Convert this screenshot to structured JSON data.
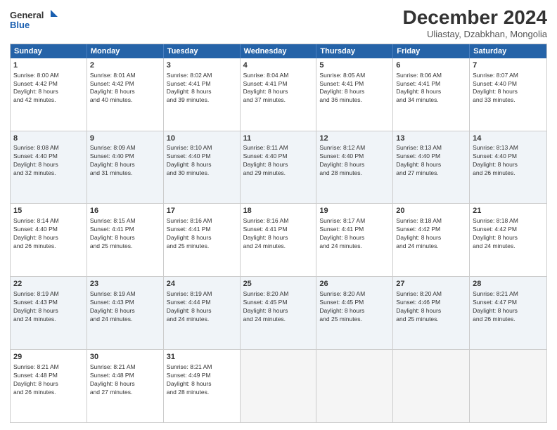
{
  "logo": {
    "line1": "General",
    "line2": "Blue"
  },
  "title": "December 2024",
  "location": "Uliastay, Dzabkhan, Mongolia",
  "header_days": [
    "Sunday",
    "Monday",
    "Tuesday",
    "Wednesday",
    "Thursday",
    "Friday",
    "Saturday"
  ],
  "weeks": [
    [
      {
        "day": "1",
        "lines": [
          "Sunrise: 8:00 AM",
          "Sunset: 4:42 PM",
          "Daylight: 8 hours",
          "and 42 minutes."
        ],
        "shaded": false
      },
      {
        "day": "2",
        "lines": [
          "Sunrise: 8:01 AM",
          "Sunset: 4:42 PM",
          "Daylight: 8 hours",
          "and 40 minutes."
        ],
        "shaded": false
      },
      {
        "day": "3",
        "lines": [
          "Sunrise: 8:02 AM",
          "Sunset: 4:41 PM",
          "Daylight: 8 hours",
          "and 39 minutes."
        ],
        "shaded": false
      },
      {
        "day": "4",
        "lines": [
          "Sunrise: 8:04 AM",
          "Sunset: 4:41 PM",
          "Daylight: 8 hours",
          "and 37 minutes."
        ],
        "shaded": false
      },
      {
        "day": "5",
        "lines": [
          "Sunrise: 8:05 AM",
          "Sunset: 4:41 PM",
          "Daylight: 8 hours",
          "and 36 minutes."
        ],
        "shaded": false
      },
      {
        "day": "6",
        "lines": [
          "Sunrise: 8:06 AM",
          "Sunset: 4:41 PM",
          "Daylight: 8 hours",
          "and 34 minutes."
        ],
        "shaded": false
      },
      {
        "day": "7",
        "lines": [
          "Sunrise: 8:07 AM",
          "Sunset: 4:40 PM",
          "Daylight: 8 hours",
          "and 33 minutes."
        ],
        "shaded": false
      }
    ],
    [
      {
        "day": "8",
        "lines": [
          "Sunrise: 8:08 AM",
          "Sunset: 4:40 PM",
          "Daylight: 8 hours",
          "and 32 minutes."
        ],
        "shaded": true
      },
      {
        "day": "9",
        "lines": [
          "Sunrise: 8:09 AM",
          "Sunset: 4:40 PM",
          "Daylight: 8 hours",
          "and 31 minutes."
        ],
        "shaded": true
      },
      {
        "day": "10",
        "lines": [
          "Sunrise: 8:10 AM",
          "Sunset: 4:40 PM",
          "Daylight: 8 hours",
          "and 30 minutes."
        ],
        "shaded": true
      },
      {
        "day": "11",
        "lines": [
          "Sunrise: 8:11 AM",
          "Sunset: 4:40 PM",
          "Daylight: 8 hours",
          "and 29 minutes."
        ],
        "shaded": true
      },
      {
        "day": "12",
        "lines": [
          "Sunrise: 8:12 AM",
          "Sunset: 4:40 PM",
          "Daylight: 8 hours",
          "and 28 minutes."
        ],
        "shaded": true
      },
      {
        "day": "13",
        "lines": [
          "Sunrise: 8:13 AM",
          "Sunset: 4:40 PM",
          "Daylight: 8 hours",
          "and 27 minutes."
        ],
        "shaded": true
      },
      {
        "day": "14",
        "lines": [
          "Sunrise: 8:13 AM",
          "Sunset: 4:40 PM",
          "Daylight: 8 hours",
          "and 26 minutes."
        ],
        "shaded": true
      }
    ],
    [
      {
        "day": "15",
        "lines": [
          "Sunrise: 8:14 AM",
          "Sunset: 4:40 PM",
          "Daylight: 8 hours",
          "and 26 minutes."
        ],
        "shaded": false
      },
      {
        "day": "16",
        "lines": [
          "Sunrise: 8:15 AM",
          "Sunset: 4:41 PM",
          "Daylight: 8 hours",
          "and 25 minutes."
        ],
        "shaded": false
      },
      {
        "day": "17",
        "lines": [
          "Sunrise: 8:16 AM",
          "Sunset: 4:41 PM",
          "Daylight: 8 hours",
          "and 25 minutes."
        ],
        "shaded": false
      },
      {
        "day": "18",
        "lines": [
          "Sunrise: 8:16 AM",
          "Sunset: 4:41 PM",
          "Daylight: 8 hours",
          "and 24 minutes."
        ],
        "shaded": false
      },
      {
        "day": "19",
        "lines": [
          "Sunrise: 8:17 AM",
          "Sunset: 4:41 PM",
          "Daylight: 8 hours",
          "and 24 minutes."
        ],
        "shaded": false
      },
      {
        "day": "20",
        "lines": [
          "Sunrise: 8:18 AM",
          "Sunset: 4:42 PM",
          "Daylight: 8 hours",
          "and 24 minutes."
        ],
        "shaded": false
      },
      {
        "day": "21",
        "lines": [
          "Sunrise: 8:18 AM",
          "Sunset: 4:42 PM",
          "Daylight: 8 hours",
          "and 24 minutes."
        ],
        "shaded": false
      }
    ],
    [
      {
        "day": "22",
        "lines": [
          "Sunrise: 8:19 AM",
          "Sunset: 4:43 PM",
          "Daylight: 8 hours",
          "and 24 minutes."
        ],
        "shaded": true
      },
      {
        "day": "23",
        "lines": [
          "Sunrise: 8:19 AM",
          "Sunset: 4:43 PM",
          "Daylight: 8 hours",
          "and 24 minutes."
        ],
        "shaded": true
      },
      {
        "day": "24",
        "lines": [
          "Sunrise: 8:19 AM",
          "Sunset: 4:44 PM",
          "Daylight: 8 hours",
          "and 24 minutes."
        ],
        "shaded": true
      },
      {
        "day": "25",
        "lines": [
          "Sunrise: 8:20 AM",
          "Sunset: 4:45 PM",
          "Daylight: 8 hours",
          "and 24 minutes."
        ],
        "shaded": true
      },
      {
        "day": "26",
        "lines": [
          "Sunrise: 8:20 AM",
          "Sunset: 4:45 PM",
          "Daylight: 8 hours",
          "and 25 minutes."
        ],
        "shaded": true
      },
      {
        "day": "27",
        "lines": [
          "Sunrise: 8:20 AM",
          "Sunset: 4:46 PM",
          "Daylight: 8 hours",
          "and 25 minutes."
        ],
        "shaded": true
      },
      {
        "day": "28",
        "lines": [
          "Sunrise: 8:21 AM",
          "Sunset: 4:47 PM",
          "Daylight: 8 hours",
          "and 26 minutes."
        ],
        "shaded": true
      }
    ],
    [
      {
        "day": "29",
        "lines": [
          "Sunrise: 8:21 AM",
          "Sunset: 4:48 PM",
          "Daylight: 8 hours",
          "and 26 minutes."
        ],
        "shaded": false
      },
      {
        "day": "30",
        "lines": [
          "Sunrise: 8:21 AM",
          "Sunset: 4:48 PM",
          "Daylight: 8 hours",
          "and 27 minutes."
        ],
        "shaded": false
      },
      {
        "day": "31",
        "lines": [
          "Sunrise: 8:21 AM",
          "Sunset: 4:49 PM",
          "Daylight: 8 hours",
          "and 28 minutes."
        ],
        "shaded": false
      },
      {
        "day": "",
        "lines": [],
        "shaded": false,
        "empty": true
      },
      {
        "day": "",
        "lines": [],
        "shaded": false,
        "empty": true
      },
      {
        "day": "",
        "lines": [],
        "shaded": false,
        "empty": true
      },
      {
        "day": "",
        "lines": [],
        "shaded": false,
        "empty": true
      }
    ]
  ]
}
